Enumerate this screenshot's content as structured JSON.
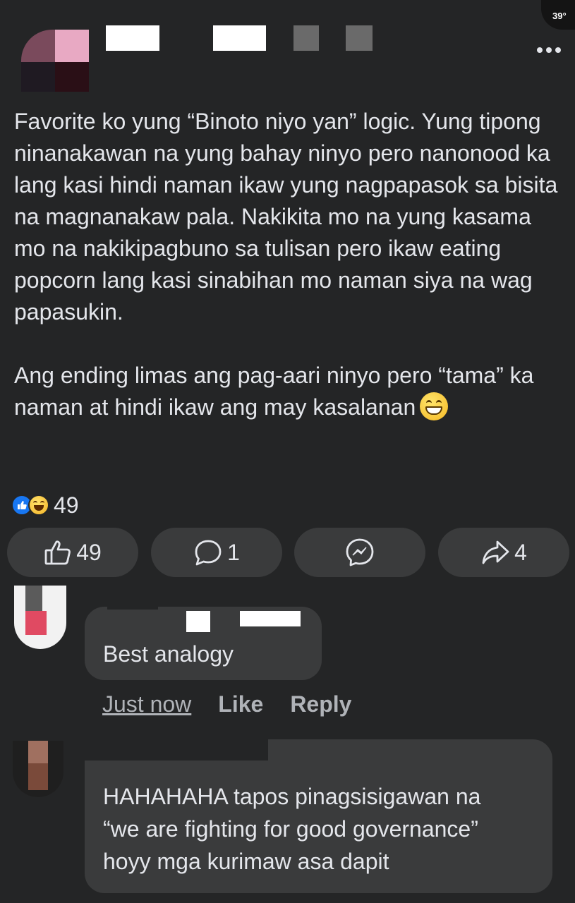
{
  "status": {
    "temperature": "39°"
  },
  "post": {
    "paragraphs": [
      "Favorite ko yung “Binoto niyo yan” logic. Yung tipong ninanakawan na yung bahay ninyo pero nanonood ka lang kasi hindi naman ikaw yung nagpapasok sa bisita na magnanakaw pala. Nakikita mo na yung kasama mo na nakikipagbuno sa tulisan pero ikaw eating popcorn lang kasi sinabihan mo naman siya na wag papasukin.",
      "Ang ending limas ang pag-aari ninyo pero “tama” ka naman at hindi ikaw ang may kasalanan"
    ],
    "emoji_name": "grinning-face-icon",
    "reaction_count": "49"
  },
  "actions": {
    "like_count": "49",
    "comment_count": "1",
    "share_count": "4"
  },
  "comments": [
    {
      "text": "Best analogy",
      "time": "Just now",
      "like_label": "Like",
      "reply_label": "Reply"
    },
    {
      "text": "HAHAHAHA tapos pinagsisigawan na\n“we are fighting for good governance”\nhoyy mga kurimaw asa dapit"
    }
  ],
  "colors": {
    "background": "#242526",
    "bubble": "#3a3b3c",
    "text": "#e4e6eb",
    "muted": "#b0b3b8",
    "like_blue": "#1877f2"
  }
}
